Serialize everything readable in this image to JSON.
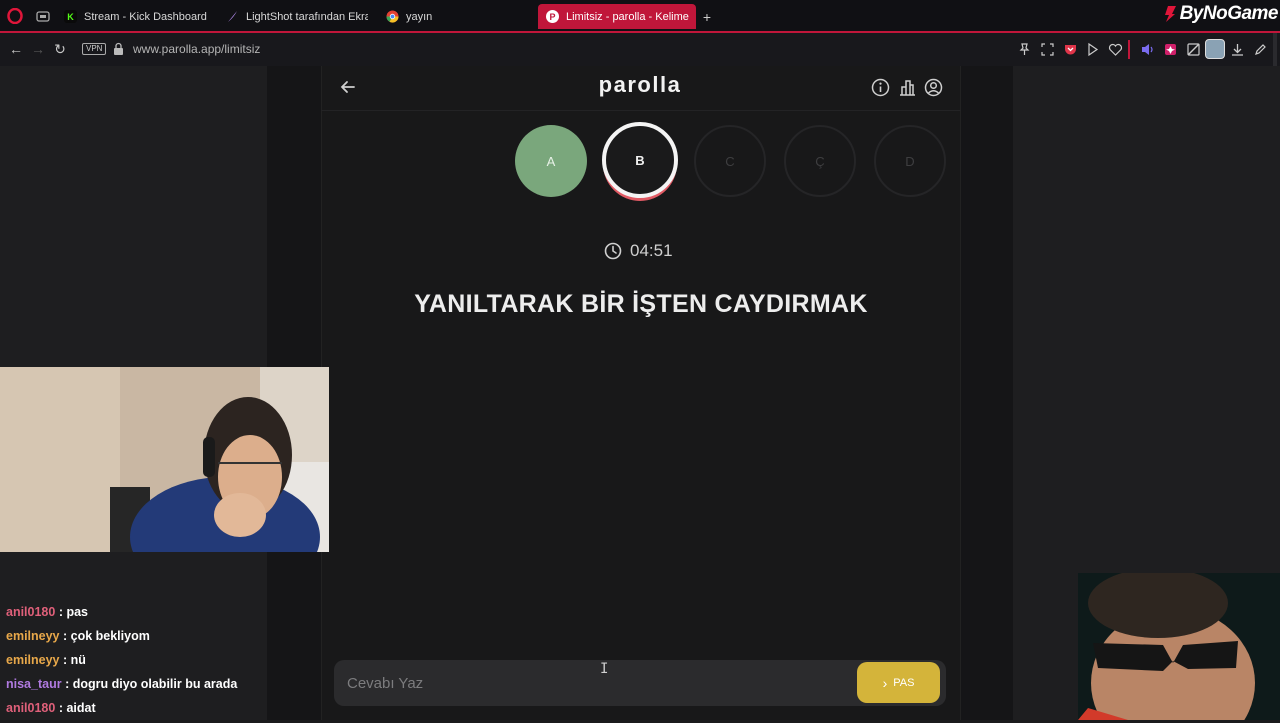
{
  "browser": {
    "tabs": [
      {
        "label": "Stream - Kick Dashboard",
        "fav": "K"
      },
      {
        "label": "LightShot tarafından Ekra",
        "fav": ""
      },
      {
        "label": "yayın",
        "fav": ""
      },
      {
        "label": "Limitsiz - parolla - Kelime",
        "fav": "P"
      }
    ],
    "new_tab": "+",
    "url": "www.parolla.app/limitsiz",
    "vpn_label": "VPN",
    "brand": "ByNoGame"
  },
  "game": {
    "logo": "parolla",
    "letters": [
      {
        "letter": "A",
        "state": "done"
      },
      {
        "letter": "B",
        "state": "active"
      },
      {
        "letter": "C",
        "state": "pending"
      },
      {
        "letter": "Ç",
        "state": "pending"
      },
      {
        "letter": "D",
        "state": "pending"
      }
    ],
    "timer": "04:51",
    "clue": "YANILTARAK BİR İŞTEN CAYDIRMAK",
    "answer_placeholder": "Cevabı Yaz",
    "pass_label": "PAS",
    "accent_color": "#d4b43a",
    "done_color": "#7aa77c"
  },
  "chat": {
    "messages": [
      {
        "user": "anil0180",
        "text": " : pas",
        "color": "#e0607a"
      },
      {
        "user": "emilneyy",
        "text": " : çok bekliyom",
        "color": "#e8a84a"
      },
      {
        "user": "emilneyy",
        "text": " : nü",
        "color": "#e8a84a"
      },
      {
        "user": "nisa_taur",
        "text": " : dogru diyo olabilir bu arada",
        "color": "#b07ae0"
      },
      {
        "user": "anil0180",
        "text": " : aidat",
        "color": "#e0607a"
      }
    ]
  }
}
